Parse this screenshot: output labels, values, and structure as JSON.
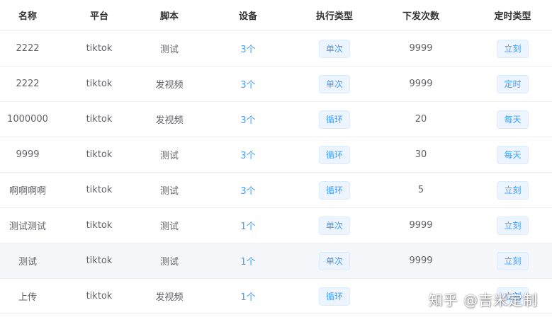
{
  "table": {
    "headers": [
      "名称",
      "平台",
      "脚本",
      "设备",
      "执行类型",
      "下发次数",
      "定时类型"
    ],
    "rows": [
      {
        "name": "2222",
        "platform": "tiktok",
        "script": "测试",
        "device": "3个",
        "exec_type": "单次",
        "count": "9999",
        "timer_type": "立刻"
      },
      {
        "name": "2222",
        "platform": "tiktok",
        "script": "发视频",
        "device": "3个",
        "exec_type": "单次",
        "count": "9999",
        "timer_type": "定时"
      },
      {
        "name": "1000000",
        "platform": "tiktok",
        "script": "发视频",
        "device": "3个",
        "exec_type": "循环",
        "count": "20",
        "timer_type": "每天"
      },
      {
        "name": "9999",
        "platform": "tiktok",
        "script": "测试",
        "device": "3个",
        "exec_type": "循环",
        "count": "30",
        "timer_type": "每天"
      },
      {
        "name": "啊啊啊啊",
        "platform": "tiktok",
        "script": "测试",
        "device": "3个",
        "exec_type": "循环",
        "count": "5",
        "timer_type": "立刻"
      },
      {
        "name": "测试测试",
        "platform": "tiktok",
        "script": "测试",
        "device": "1个",
        "exec_type": "单次",
        "count": "9999",
        "timer_type": "立刻"
      },
      {
        "name": "测试",
        "platform": "tiktok",
        "script": "测试",
        "device": "1个",
        "exec_type": "单次",
        "count": "9999",
        "timer_type": "立刻"
      },
      {
        "name": "上传",
        "platform": "tiktok",
        "script": "发视频",
        "device": "1个",
        "exec_type": "循环",
        "count": "",
        "timer_type": "立刻"
      }
    ]
  },
  "watermark": "知乎 @吉米定制",
  "colors": {
    "link": "#409eff",
    "tag_bg": "#ecf5ff",
    "tag_border": "#d9ecff",
    "row_hover": "#f5f7fa",
    "border": "#ebeef5"
  }
}
